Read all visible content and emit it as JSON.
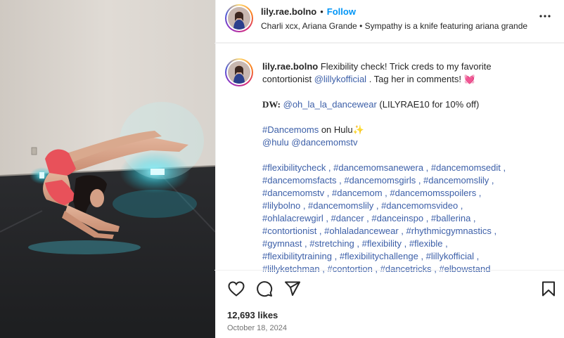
{
  "post": {
    "username": "lily.rae.bolno",
    "follow_label": "Follow",
    "separator": "•",
    "audio": "Charli xcx, Ariana Grande • Sympathy is a knife featuring ariana grande",
    "more_label": "•••",
    "caption": {
      "username": "lily.rae.bolno",
      "line1_text": " Flexibility check! Trick creds to my favorite contortionist ",
      "mention1": "@lillykofficial",
      "line1_tail": " . Tag her in comments! 💓",
      "dw_label": "DW:",
      "dw_mention": "@oh_la_la_dancewear",
      "dw_tail": " (LILYRAE10 for 10% off)",
      "dancemoms_tag": "#Dancemoms",
      "dancemoms_tail": " on Hulu✨",
      "hulu_mentions": "@hulu @dancemomstv",
      "hashtags": "#flexibilitycheck , #dancemomsanewera , #dancemomsedit , #dancemomsfacts , #dancemomsgirls , #dancemomslily , #dancemomstv , #dancemom , #dancemomsspoilers , #lilybolno , #dancemomslily , #dancemomsvideo , #ohlalacrewgirl , #dancer , #danceinspo , #ballerina , #contortionist , #ohlaladancewear , #rhythmicgymnastics , #gymnast , #stretching , #flexibility , #flexible , #flexibilitytraining , #flexibilitychallenge , #lillykofficial , #lillyketchman , #contortion , #dancetricks , #elbowstand"
    },
    "likes": "12,693 likes",
    "date": "October 18, 2024"
  },
  "icons": [
    "heart-icon",
    "comment-icon",
    "share-icon",
    "bookmark-icon",
    "more-icon"
  ],
  "colors": {
    "follow": "#0095f6",
    "link": "#3c5fa8",
    "muted": "#737373",
    "floor_light": "#3fe0f0",
    "outfit": "#e8515a"
  }
}
